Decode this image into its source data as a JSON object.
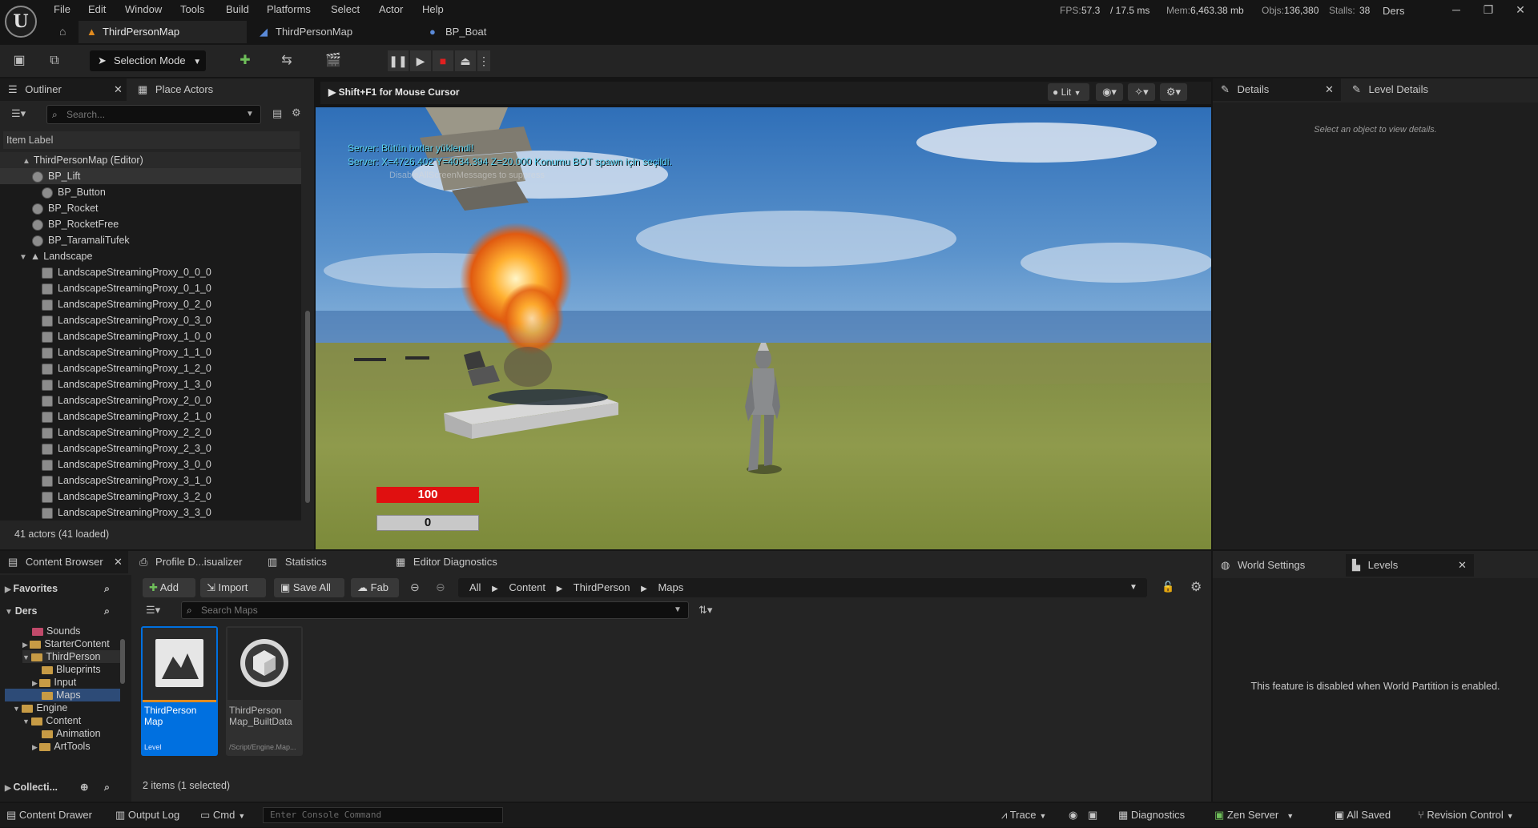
{
  "titlebar": {
    "menu": [
      "File",
      "Edit",
      "Window",
      "Tools",
      "Build",
      "Platforms",
      "Select",
      "Actor",
      "Help"
    ],
    "stats": {
      "fps_label": "FPS:",
      "fps": "57.3",
      "ms": "/ 17.5 ms",
      "mem_label": "Mem:",
      "mem": "6,463.38 mb",
      "objs_label": "Objs:",
      "objs": "136,380",
      "stalls_label": "Stalls:",
      "stalls": "38"
    },
    "project": "Ders",
    "tabs": [
      {
        "label": "ThirdPersonMap",
        "active": true
      },
      {
        "label": "ThirdPersonMap",
        "active": false
      },
      {
        "label": "BP_Boat",
        "active": false
      }
    ]
  },
  "toolbar": {
    "selection_mode": "Selection Mode"
  },
  "outliner": {
    "tab_label": "Outliner",
    "place_actors_label": "Place Actors",
    "search_placeholder": "Search...",
    "column_header": "Item Label",
    "root": "ThirdPersonMap (Editor)",
    "items": [
      "BP_Lift",
      "BP_Button",
      "BP_Rocket",
      "BP_RocketFree",
      "BP_TaramaliTufek",
      "Landscape",
      "LandscapeStreamingProxy_0_0_0",
      "LandscapeStreamingProxy_0_1_0",
      "LandscapeStreamingProxy_0_2_0",
      "LandscapeStreamingProxy_0_3_0",
      "LandscapeStreamingProxy_1_0_0",
      "LandscapeStreamingProxy_1_1_0",
      "LandscapeStreamingProxy_1_2_0",
      "LandscapeStreamingProxy_1_3_0",
      "LandscapeStreamingProxy_2_0_0",
      "LandscapeStreamingProxy_2_1_0",
      "LandscapeStreamingProxy_2_2_0",
      "LandscapeStreamingProxy_2_3_0",
      "LandscapeStreamingProxy_3_0_0",
      "LandscapeStreamingProxy_3_1_0",
      "LandscapeStreamingProxy_3_2_0",
      "LandscapeStreamingProxy_3_3_0"
    ],
    "status": "41 actors (41 loaded)"
  },
  "viewport": {
    "mouse_hint": "Shift+F1 for Mouse Cursor",
    "lit_label": "Lit",
    "msg1": "Server: Bütün botlar yüklendi!",
    "msg2": "Server: X=4726.402 Y=4034.394 Z=20.000 Konumu BOT spawn için seçildi.",
    "msg3": "DisableAllScreenMessages to suppress",
    "health": "100",
    "health_fraction": 1.0,
    "score": "0"
  },
  "details": {
    "tab_label": "Details",
    "level_details_label": "Level Details",
    "empty_hint": "Select an object to view details."
  },
  "content_browser": {
    "tab_label": "Content Browser",
    "other_tabs": [
      "Profile D...isualizer",
      "Statistics",
      "Editor Diagnostics"
    ],
    "favorites": "Favorites",
    "project": "Ders",
    "tree": [
      {
        "label": "Sounds",
        "depth": 2
      },
      {
        "label": "StarterContent",
        "depth": 2
      },
      {
        "label": "ThirdPerson",
        "depth": 2
      },
      {
        "label": "Blueprints",
        "depth": 3
      },
      {
        "label": "Input",
        "depth": 3
      },
      {
        "label": "Maps",
        "depth": 3
      },
      {
        "label": "Engine",
        "depth": 1
      },
      {
        "label": "Content",
        "depth": 2
      },
      {
        "label": "Animation",
        "depth": 3
      },
      {
        "label": "ArtTools",
        "depth": 3
      }
    ],
    "collections": "Collecti...",
    "buttons": {
      "add": "Add",
      "import": "Import",
      "save_all": "Save All",
      "fab": "Fab"
    },
    "breadcrumb": [
      "All",
      "Content",
      "ThirdPerson",
      "Maps"
    ],
    "search_placeholder": "Search Maps",
    "assets": [
      {
        "name": "ThirdPerson Map",
        "type": "Level",
        "selected": true
      },
      {
        "name": "ThirdPerson Map_BuiltData",
        "type": "/Script/Engine.Map...",
        "selected": false
      }
    ],
    "status": "2 items (1 selected)"
  },
  "world_panel": {
    "world_settings": "World Settings",
    "levels": "Levels",
    "message": "This feature is disabled when World Partition is enabled."
  },
  "statusbar": {
    "content_drawer": "Content Drawer",
    "output_log": "Output Log",
    "cmd": "Cmd",
    "console_placeholder": "Enter Console Command",
    "trace": "Trace",
    "diagnostics": "Diagnostics",
    "zen_server": "Zen Server",
    "all_saved": "All Saved",
    "revision_control": "Revision Control"
  },
  "colors": {
    "accent": "#0070e0",
    "health_red": "#e01010",
    "folder": "#c79b45"
  }
}
